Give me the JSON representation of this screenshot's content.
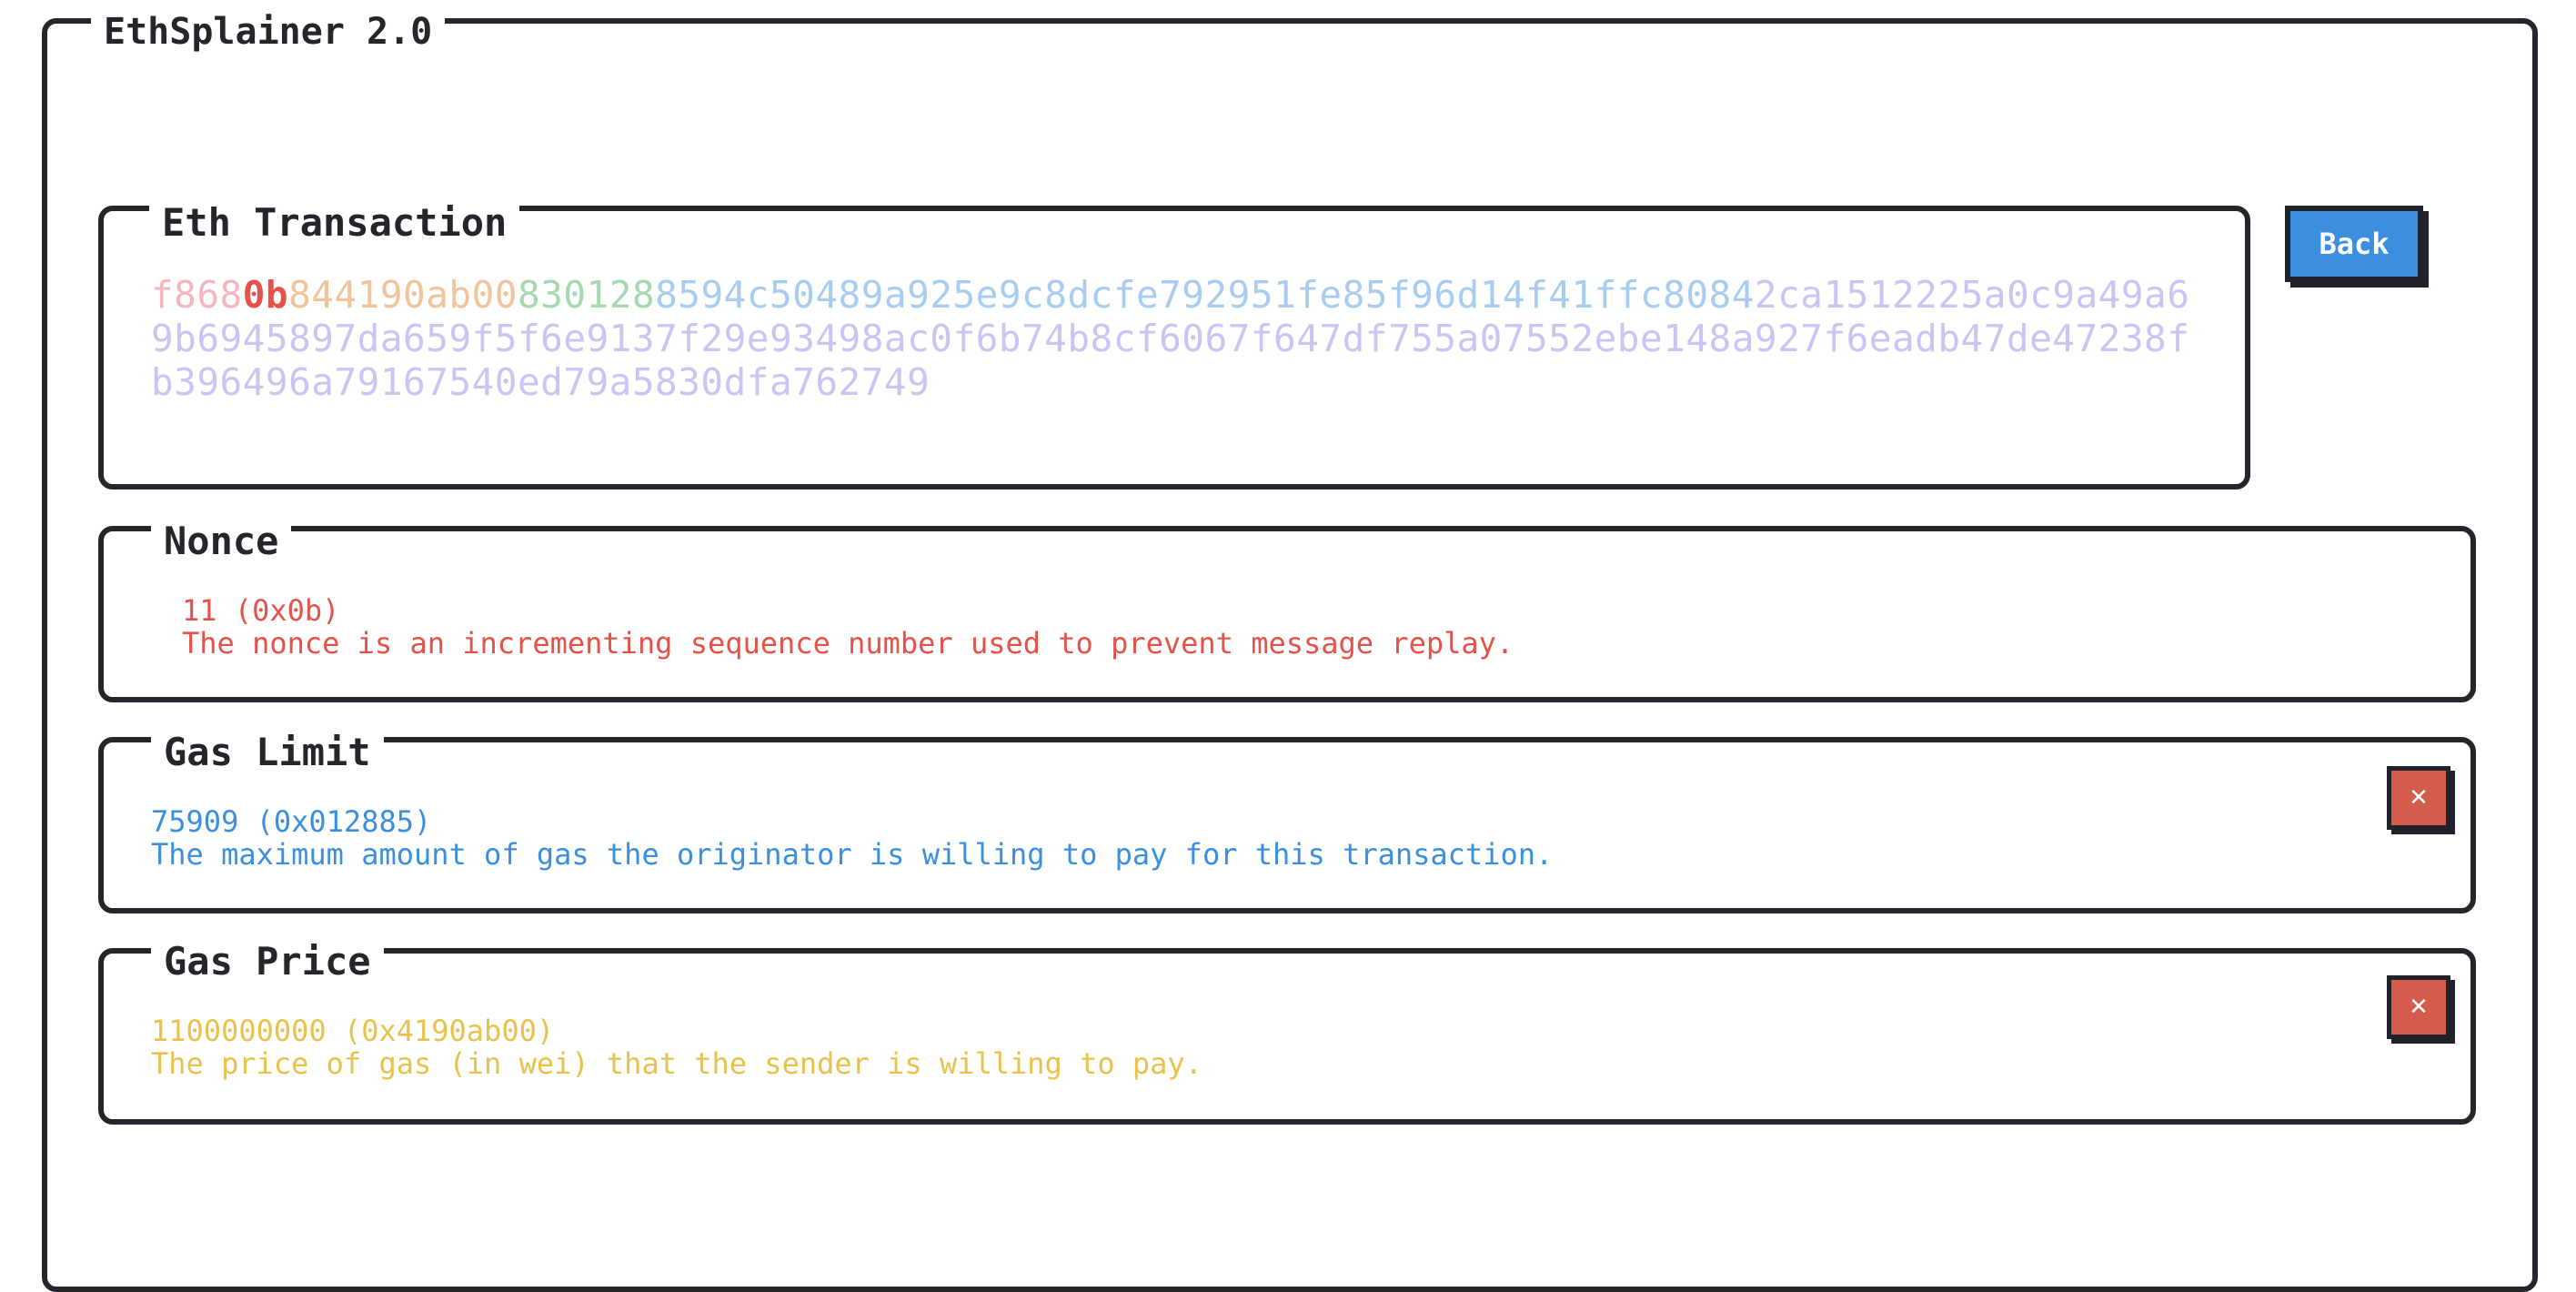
{
  "app": {
    "title": "EthSplainer 2.0"
  },
  "transaction": {
    "title": "Eth Transaction",
    "hex_segments": [
      {
        "text": "f868",
        "color": "#f4b7c2"
      },
      {
        "text": "0b",
        "color": "#e4524a"
      },
      {
        "text": "844190ab00",
        "color": "#f2c49b"
      },
      {
        "text": "830128",
        "color": "#a7d8b0"
      },
      {
        "text": "8594c50489a925e9c8dcfe792951fe85f96d14f41ffc8084",
        "color": "#a9cdf0"
      },
      {
        "text": "2ca1512225a0c9a49a69b6945897da659f5f6e9137f29e93498ac0f6b74b8cf6067f647df755a07552ebe148a927f6eadb47de47238fb396496a79167540ed79a5830dfa762749",
        "color": "#c9c6f3"
      }
    ],
    "back_label": "Back"
  },
  "nonce": {
    "title": "Nonce",
    "value": "11 (0x0b)",
    "description": "The nonce is an incrementing sequence number used to prevent message replay.",
    "color": "#e4524a"
  },
  "gas_limit": {
    "title": "Gas Limit",
    "value": "75909 (0x012885)",
    "description": "The maximum amount of gas the originator is willing to pay for this transaction.",
    "color": "#3b8fde",
    "close_icon": "close-icon"
  },
  "gas_price": {
    "title": "Gas Price",
    "value": "1100000000 (0x4190ab00)",
    "description": "The price of gas (in wei) that the sender is willing to pay.",
    "color": "#e8c24c",
    "close_icon": "close-icon"
  }
}
